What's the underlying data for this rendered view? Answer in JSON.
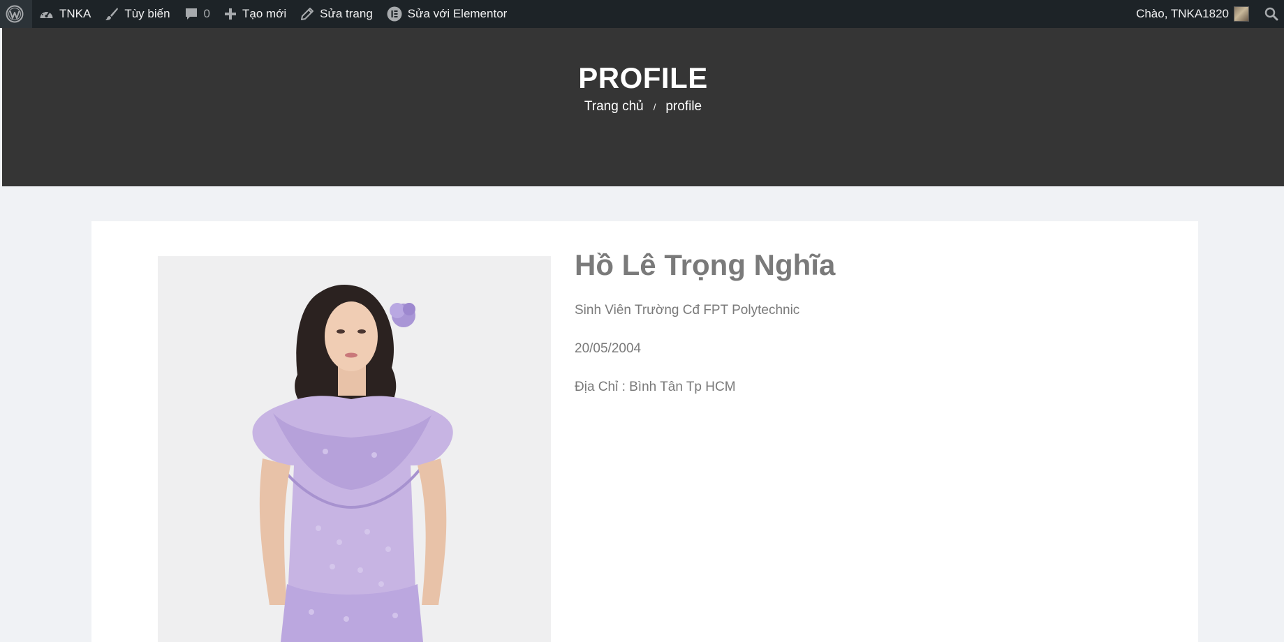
{
  "admin_bar": {
    "site_name": "TNKA",
    "customize_label": "Tùy biến",
    "comments_count": "0",
    "new_label": "Tạo mới",
    "edit_page_label": "Sửa trang",
    "elementor_label": "Sửa với Elementor",
    "greeting": "Chào, TNKA1820",
    "colors": {
      "background": "#1d2327",
      "text": "#f0f0f1"
    }
  },
  "header": {
    "title": "PROFILE",
    "breadcrumb": {
      "home": "Trang chủ",
      "separator": "/",
      "current": "profile"
    },
    "background": "#353535"
  },
  "profile": {
    "name": "Hồ Lê Trọng Nghĩa",
    "school": "Sinh Viên Trường Cđ FPT Polytechnic",
    "birthdate": "20/05/2004",
    "address": "Địa Chỉ : Bình Tân Tp HCM",
    "text_color": "#7a7a7a"
  },
  "icons": {
    "wordpress": "wordpress-logo-icon",
    "dashboard": "dashboard-gauge-icon",
    "customize": "paintbrush-icon",
    "comments": "comment-bubble-icon",
    "new": "plus-icon",
    "edit": "pencil-icon",
    "elementor": "elementor-icon",
    "search": "search-icon"
  }
}
